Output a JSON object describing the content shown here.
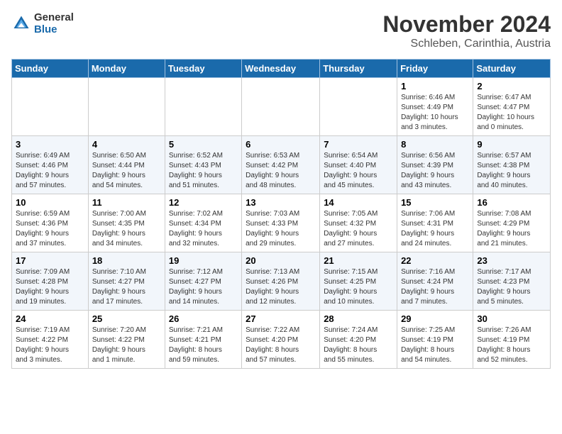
{
  "header": {
    "logo_general": "General",
    "logo_blue": "Blue",
    "month_title": "November 2024",
    "location": "Schleben, Carinthia, Austria"
  },
  "weekdays": [
    "Sunday",
    "Monday",
    "Tuesday",
    "Wednesday",
    "Thursday",
    "Friday",
    "Saturday"
  ],
  "weeks": [
    [
      {
        "day": "",
        "info": ""
      },
      {
        "day": "",
        "info": ""
      },
      {
        "day": "",
        "info": ""
      },
      {
        "day": "",
        "info": ""
      },
      {
        "day": "",
        "info": ""
      },
      {
        "day": "1",
        "info": "Sunrise: 6:46 AM\nSunset: 4:49 PM\nDaylight: 10 hours\nand 3 minutes."
      },
      {
        "day": "2",
        "info": "Sunrise: 6:47 AM\nSunset: 4:47 PM\nDaylight: 10 hours\nand 0 minutes."
      }
    ],
    [
      {
        "day": "3",
        "info": "Sunrise: 6:49 AM\nSunset: 4:46 PM\nDaylight: 9 hours\nand 57 minutes."
      },
      {
        "day": "4",
        "info": "Sunrise: 6:50 AM\nSunset: 4:44 PM\nDaylight: 9 hours\nand 54 minutes."
      },
      {
        "day": "5",
        "info": "Sunrise: 6:52 AM\nSunset: 4:43 PM\nDaylight: 9 hours\nand 51 minutes."
      },
      {
        "day": "6",
        "info": "Sunrise: 6:53 AM\nSunset: 4:42 PM\nDaylight: 9 hours\nand 48 minutes."
      },
      {
        "day": "7",
        "info": "Sunrise: 6:54 AM\nSunset: 4:40 PM\nDaylight: 9 hours\nand 45 minutes."
      },
      {
        "day": "8",
        "info": "Sunrise: 6:56 AM\nSunset: 4:39 PM\nDaylight: 9 hours\nand 43 minutes."
      },
      {
        "day": "9",
        "info": "Sunrise: 6:57 AM\nSunset: 4:38 PM\nDaylight: 9 hours\nand 40 minutes."
      }
    ],
    [
      {
        "day": "10",
        "info": "Sunrise: 6:59 AM\nSunset: 4:36 PM\nDaylight: 9 hours\nand 37 minutes."
      },
      {
        "day": "11",
        "info": "Sunrise: 7:00 AM\nSunset: 4:35 PM\nDaylight: 9 hours\nand 34 minutes."
      },
      {
        "day": "12",
        "info": "Sunrise: 7:02 AM\nSunset: 4:34 PM\nDaylight: 9 hours\nand 32 minutes."
      },
      {
        "day": "13",
        "info": "Sunrise: 7:03 AM\nSunset: 4:33 PM\nDaylight: 9 hours\nand 29 minutes."
      },
      {
        "day": "14",
        "info": "Sunrise: 7:05 AM\nSunset: 4:32 PM\nDaylight: 9 hours\nand 27 minutes."
      },
      {
        "day": "15",
        "info": "Sunrise: 7:06 AM\nSunset: 4:31 PM\nDaylight: 9 hours\nand 24 minutes."
      },
      {
        "day": "16",
        "info": "Sunrise: 7:08 AM\nSunset: 4:29 PM\nDaylight: 9 hours\nand 21 minutes."
      }
    ],
    [
      {
        "day": "17",
        "info": "Sunrise: 7:09 AM\nSunset: 4:28 PM\nDaylight: 9 hours\nand 19 minutes."
      },
      {
        "day": "18",
        "info": "Sunrise: 7:10 AM\nSunset: 4:27 PM\nDaylight: 9 hours\nand 17 minutes."
      },
      {
        "day": "19",
        "info": "Sunrise: 7:12 AM\nSunset: 4:27 PM\nDaylight: 9 hours\nand 14 minutes."
      },
      {
        "day": "20",
        "info": "Sunrise: 7:13 AM\nSunset: 4:26 PM\nDaylight: 9 hours\nand 12 minutes."
      },
      {
        "day": "21",
        "info": "Sunrise: 7:15 AM\nSunset: 4:25 PM\nDaylight: 9 hours\nand 10 minutes."
      },
      {
        "day": "22",
        "info": "Sunrise: 7:16 AM\nSunset: 4:24 PM\nDaylight: 9 hours\nand 7 minutes."
      },
      {
        "day": "23",
        "info": "Sunrise: 7:17 AM\nSunset: 4:23 PM\nDaylight: 9 hours\nand 5 minutes."
      }
    ],
    [
      {
        "day": "24",
        "info": "Sunrise: 7:19 AM\nSunset: 4:22 PM\nDaylight: 9 hours\nand 3 minutes."
      },
      {
        "day": "25",
        "info": "Sunrise: 7:20 AM\nSunset: 4:22 PM\nDaylight: 9 hours\nand 1 minute."
      },
      {
        "day": "26",
        "info": "Sunrise: 7:21 AM\nSunset: 4:21 PM\nDaylight: 8 hours\nand 59 minutes."
      },
      {
        "day": "27",
        "info": "Sunrise: 7:22 AM\nSunset: 4:20 PM\nDaylight: 8 hours\nand 57 minutes."
      },
      {
        "day": "28",
        "info": "Sunrise: 7:24 AM\nSunset: 4:20 PM\nDaylight: 8 hours\nand 55 minutes."
      },
      {
        "day": "29",
        "info": "Sunrise: 7:25 AM\nSunset: 4:19 PM\nDaylight: 8 hours\nand 54 minutes."
      },
      {
        "day": "30",
        "info": "Sunrise: 7:26 AM\nSunset: 4:19 PM\nDaylight: 8 hours\nand 52 minutes."
      }
    ]
  ]
}
